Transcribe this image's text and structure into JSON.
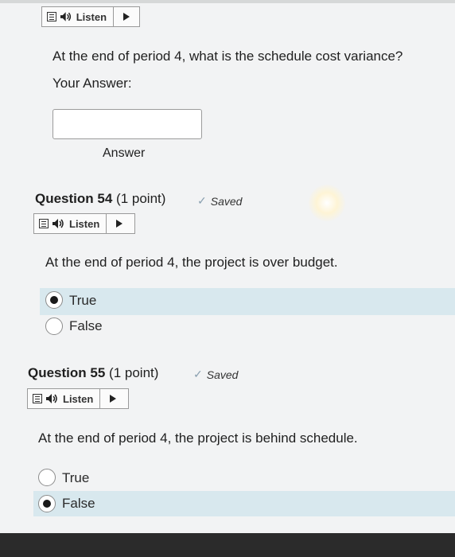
{
  "listen_label": "Listen",
  "q53": {
    "prompt": "At the end of period 4, what is the schedule cost variance?",
    "your_answer_label": "Your Answer:",
    "answer_value": "",
    "answer_caption": "Answer"
  },
  "q54": {
    "title": "Question 54",
    "points": "(1 point)",
    "status": "Saved",
    "prompt": "At the end of period 4, the project is over budget.",
    "options": [
      "True",
      "False"
    ],
    "selected": "True"
  },
  "q55": {
    "title": "Question 55",
    "points": "(1 point)",
    "status": "Saved",
    "prompt": "At the end of period 4, the project is behind schedule.",
    "options": [
      "True",
      "False"
    ],
    "selected": "False"
  },
  "colors": {
    "selected_highlight": "#d8e8ee",
    "saved_check": "#8aa0b0"
  },
  "icons": [
    "document-icon",
    "speaker-icon",
    "play-icon",
    "checkmark-icon",
    "radio-button"
  ]
}
